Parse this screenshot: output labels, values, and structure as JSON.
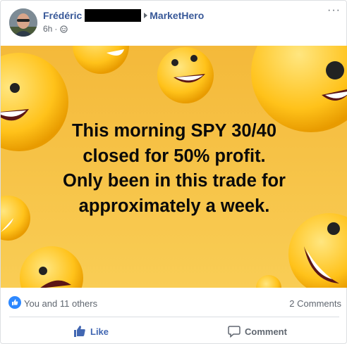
{
  "post": {
    "author": "Frédéric",
    "group": "MarketHero",
    "time": "6h",
    "time_separator": "·",
    "privacy_icon": "globe-icon",
    "more_icon": "more-options-icon",
    "more_glyph": "···"
  },
  "image": {
    "caption_lines": [
      "This morning SPY 30/40",
      "closed for 50% profit.",
      "Only been in this trade for",
      "approximately a week."
    ],
    "background_color": "#f6c142",
    "emoji_icon": "smiley-emoji-icon"
  },
  "reactions": {
    "icon": "like-badge-icon",
    "text": "You and 11 others",
    "comments": "2 Comments"
  },
  "actions": {
    "like_label": "Like",
    "comment_label": "Comment"
  },
  "colors": {
    "link": "#385898",
    "like_active": "#4267b2",
    "secondary_text": "#606770"
  }
}
